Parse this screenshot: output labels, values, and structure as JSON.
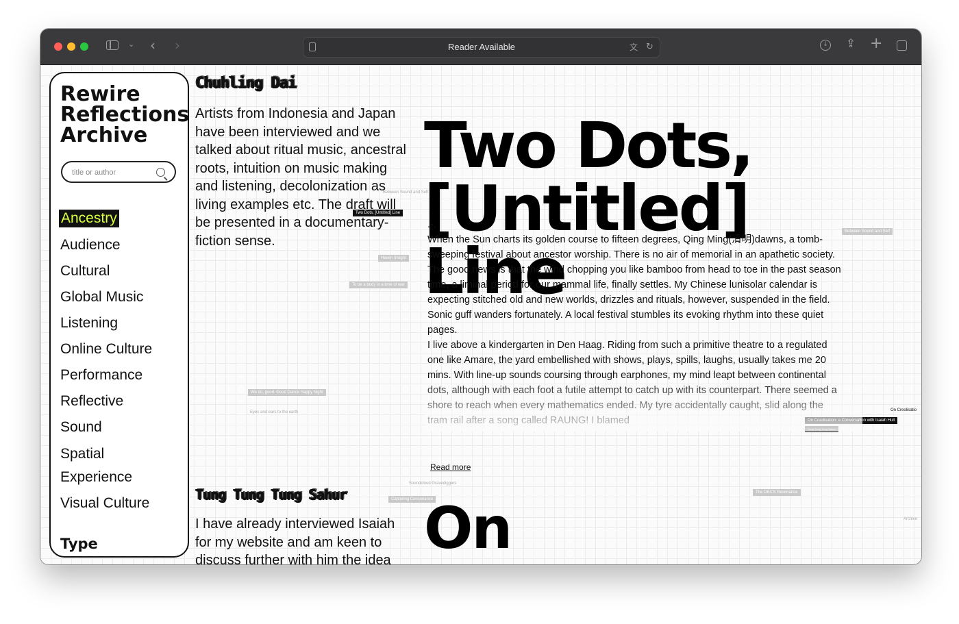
{
  "browser": {
    "address_text": "Reader Available",
    "colors": {
      "close": "#ff5f57",
      "minimize": "#febc2e",
      "zoom": "#28c840"
    }
  },
  "site": {
    "title_lines": [
      "Rewire",
      "Reflections",
      "Archive"
    ],
    "search": {
      "placeholder": "title or author"
    },
    "tags": [
      "Ancestry",
      "Audience",
      "Cultural",
      "Global Music",
      "Listening",
      "Online Culture",
      "Performance",
      "Reflective",
      "Sound",
      "Spatial",
      "Experience",
      "Visual Culture",
      "Type"
    ],
    "active_tag": "Ancestry",
    "accent": "#d7ff3d"
  },
  "entries": [
    {
      "author": "Chuhling Dai",
      "excerpt": "Artists from Indonesia and Japan have been interviewed and we talked about ritual music, ancestral roots, intuition on music making and listening, decolonization as living examples etc. The draft will be presented in a documentary-fiction sense.",
      "title_lines": [
        "Two Dots,",
        "[Untitled] Line"
      ],
      "divider": ".-.",
      "paragraph_1": "When the Sun charts its golden course to fifteen degrees, Qing Ming(清明)dawns, a tomb-sweeping festival about ancestor worship. There is no air of memorial in an apathetic society. The good news is that the wind chopping you like bamboo from head to toe in the past season time, a liminal period for our mammal life, finally settles. My Chinese lunisolar calendar is expecting stitched old and new worlds, drizzles and rituals, however, suspended in the field. Sonic guff wanders fortunately. A local festival stumbles its evoking rhythm into these quiet pages.",
      "paragraph_2": "I live above a kindergarten in Den Haag. Riding from such a primitive theatre to a regulated one like Amare, the yard embellished with shows, plays, spills, laughs, usually takes me 20 mins. With line-up sounds coursing through earphones, my mind leapt between continental dots, although with each foot a futile attempt to catch up with its counterpart. There seemed a shore to reach when every mathematics ended. My tyre accidentally caught, slid along the tram rail after a song called RAUNG! I blamed",
      "read_more": "Read more"
    },
    {
      "author": "Tung Tung Tung Sahur",
      "excerpt": "I have already interviewed Isaiah for my website and am keen to discuss further with him the idea",
      "title_lines": [
        "On Creolisation:"
      ]
    }
  ],
  "floating_chips": {
    "two_dots": "Two Dots, [Untitled] Line",
    "on_creolisation": "On Creolisation: a Conversation with Isaiah Hull",
    "on_creolisation_short": "On Creolisatio",
    "author_chip": "Tung Tung Tung Sahur",
    "between_sound": "Between Sound and Self",
    "haven": "Haven Insight",
    "body_time": "To be a body in a time of war",
    "dance": "We do, good. Good Dance Happy Night",
    "eyes": "Eyes and ears to the earth",
    "soundcloud": "Soundcloud Gravediggers",
    "capturing": "Capturing Consonance",
    "dea": "The DEA'S Resonance",
    "archive": "Archive"
  }
}
